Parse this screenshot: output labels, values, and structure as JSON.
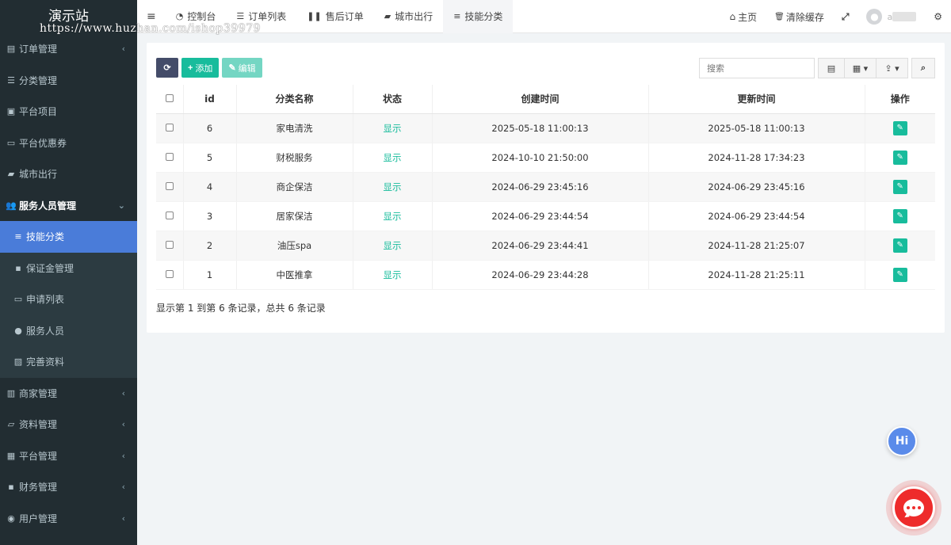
{
  "brand": {
    "title": "演示站",
    "watermark": "https://www.huzhan.com/ishop39979"
  },
  "sidebar": {
    "items_top": [
      {
        "label": "订单管理",
        "icon": "list-icon",
        "glyph": "▤",
        "chevron": "‹"
      },
      {
        "label": "分类管理",
        "icon": "sliders-icon",
        "glyph": "☰",
        "chevron": ""
      },
      {
        "label": "平台项目",
        "icon": "briefcase-icon",
        "glyph": "▣",
        "chevron": ""
      },
      {
        "label": "平台优惠券",
        "icon": "ticket-icon",
        "glyph": "▭",
        "chevron": ""
      },
      {
        "label": "城市出行",
        "icon": "car-icon",
        "glyph": "▰",
        "chevron": ""
      }
    ],
    "group_open": {
      "label": "服务人员管理",
      "icon": "users-icon",
      "glyph": "👥",
      "chevron": "⌄"
    },
    "submenu": [
      {
        "label": "技能分类",
        "icon": "bars-icon",
        "glyph": "≡",
        "active": true
      },
      {
        "label": "保证金管理",
        "icon": "dollar-icon",
        "glyph": "▪",
        "active": false
      },
      {
        "label": "申请列表",
        "icon": "id-card-icon",
        "glyph": "▭",
        "active": false
      },
      {
        "label": "服务人员",
        "icon": "user-icon",
        "glyph": "●",
        "active": false
      },
      {
        "label": "完善资料",
        "icon": "image-icon",
        "glyph": "▨",
        "active": false
      }
    ],
    "items_bottom": [
      {
        "label": "商家管理",
        "icon": "bank-icon",
        "glyph": "▥",
        "chevron": "‹"
      },
      {
        "label": "资料管理",
        "icon": "folder-icon",
        "glyph": "▱",
        "chevron": "‹"
      },
      {
        "label": "平台管理",
        "icon": "grid-icon",
        "glyph": "▦",
        "chevron": "‹"
      },
      {
        "label": "财务管理",
        "icon": "money-icon",
        "glyph": "▪",
        "chevron": "‹"
      },
      {
        "label": "用户管理",
        "icon": "user-circle-icon",
        "glyph": "◉",
        "chevron": "‹"
      }
    ]
  },
  "topbar": {
    "toggle_glyph": "≡",
    "tabs": [
      {
        "label": "控制台",
        "icon": "dashboard-icon",
        "glyph": "◔",
        "active": false
      },
      {
        "label": "订单列表",
        "icon": "list-icon",
        "glyph": "☰",
        "active": false
      },
      {
        "label": "售后订单",
        "icon": "pause-icon",
        "glyph": "❚❚",
        "active": false
      },
      {
        "label": "城市出行",
        "icon": "car-icon",
        "glyph": "▰",
        "active": false
      },
      {
        "label": "技能分类",
        "icon": "bars-icon",
        "glyph": "≡",
        "active": true
      }
    ],
    "right": {
      "home_label": "主页",
      "home_glyph": "⌂",
      "clear_cache_label": "清除缓存",
      "clear_cache_glyph": "🗑",
      "fullscreen_glyph": "⤢",
      "avatar_glyph": "●",
      "user_name": "a",
      "settings_glyph": "⚙"
    }
  },
  "toolbar": {
    "refresh_glyph": "⟳",
    "add_label": "添加",
    "add_glyph": "+",
    "edit_label": "编辑",
    "edit_glyph": "✎"
  },
  "search": {
    "placeholder": "搜索",
    "tool_glyphs": {
      "toggle": "▤",
      "columns": "▦ ▾",
      "export": "⇪ ▾",
      "search": "⌕"
    }
  },
  "table": {
    "columns": [
      "id",
      "分类名称",
      "状态",
      "创建时间",
      "更新时间",
      "操作"
    ],
    "rows": [
      {
        "id": "6",
        "name": "家电清洗",
        "status": "显示",
        "created": "2025-05-18 11:00:13",
        "updated": "2025-05-18 11:00:13"
      },
      {
        "id": "5",
        "name": "财税服务",
        "status": "显示",
        "created": "2024-10-10 21:50:00",
        "updated": "2024-11-28 17:34:23"
      },
      {
        "id": "4",
        "name": "商企保洁",
        "status": "显示",
        "created": "2024-06-29 23:45:16",
        "updated": "2024-06-29 23:45:16"
      },
      {
        "id": "3",
        "name": "居家保洁",
        "status": "显示",
        "created": "2024-06-29 23:44:54",
        "updated": "2024-06-29 23:44:54"
      },
      {
        "id": "2",
        "name": "油压spa",
        "status": "显示",
        "created": "2024-06-29 23:44:41",
        "updated": "2024-11-28 21:25:07"
      },
      {
        "id": "1",
        "name": "中医推拿",
        "status": "显示",
        "created": "2024-06-29 23:44:28",
        "updated": "2024-11-28 21:25:11"
      }
    ],
    "edit_glyph": "✎",
    "footer": "显示第 1 到第 6 条记录，总共 6 条记录"
  },
  "floating": {
    "hi_label": "Hi"
  },
  "colors": {
    "sidebar_bg": "#222d32",
    "active_blue": "#4a7cd9",
    "success": "#18bc9c",
    "primary_dark": "#444c69",
    "chat_red": "#ee2b2b"
  }
}
